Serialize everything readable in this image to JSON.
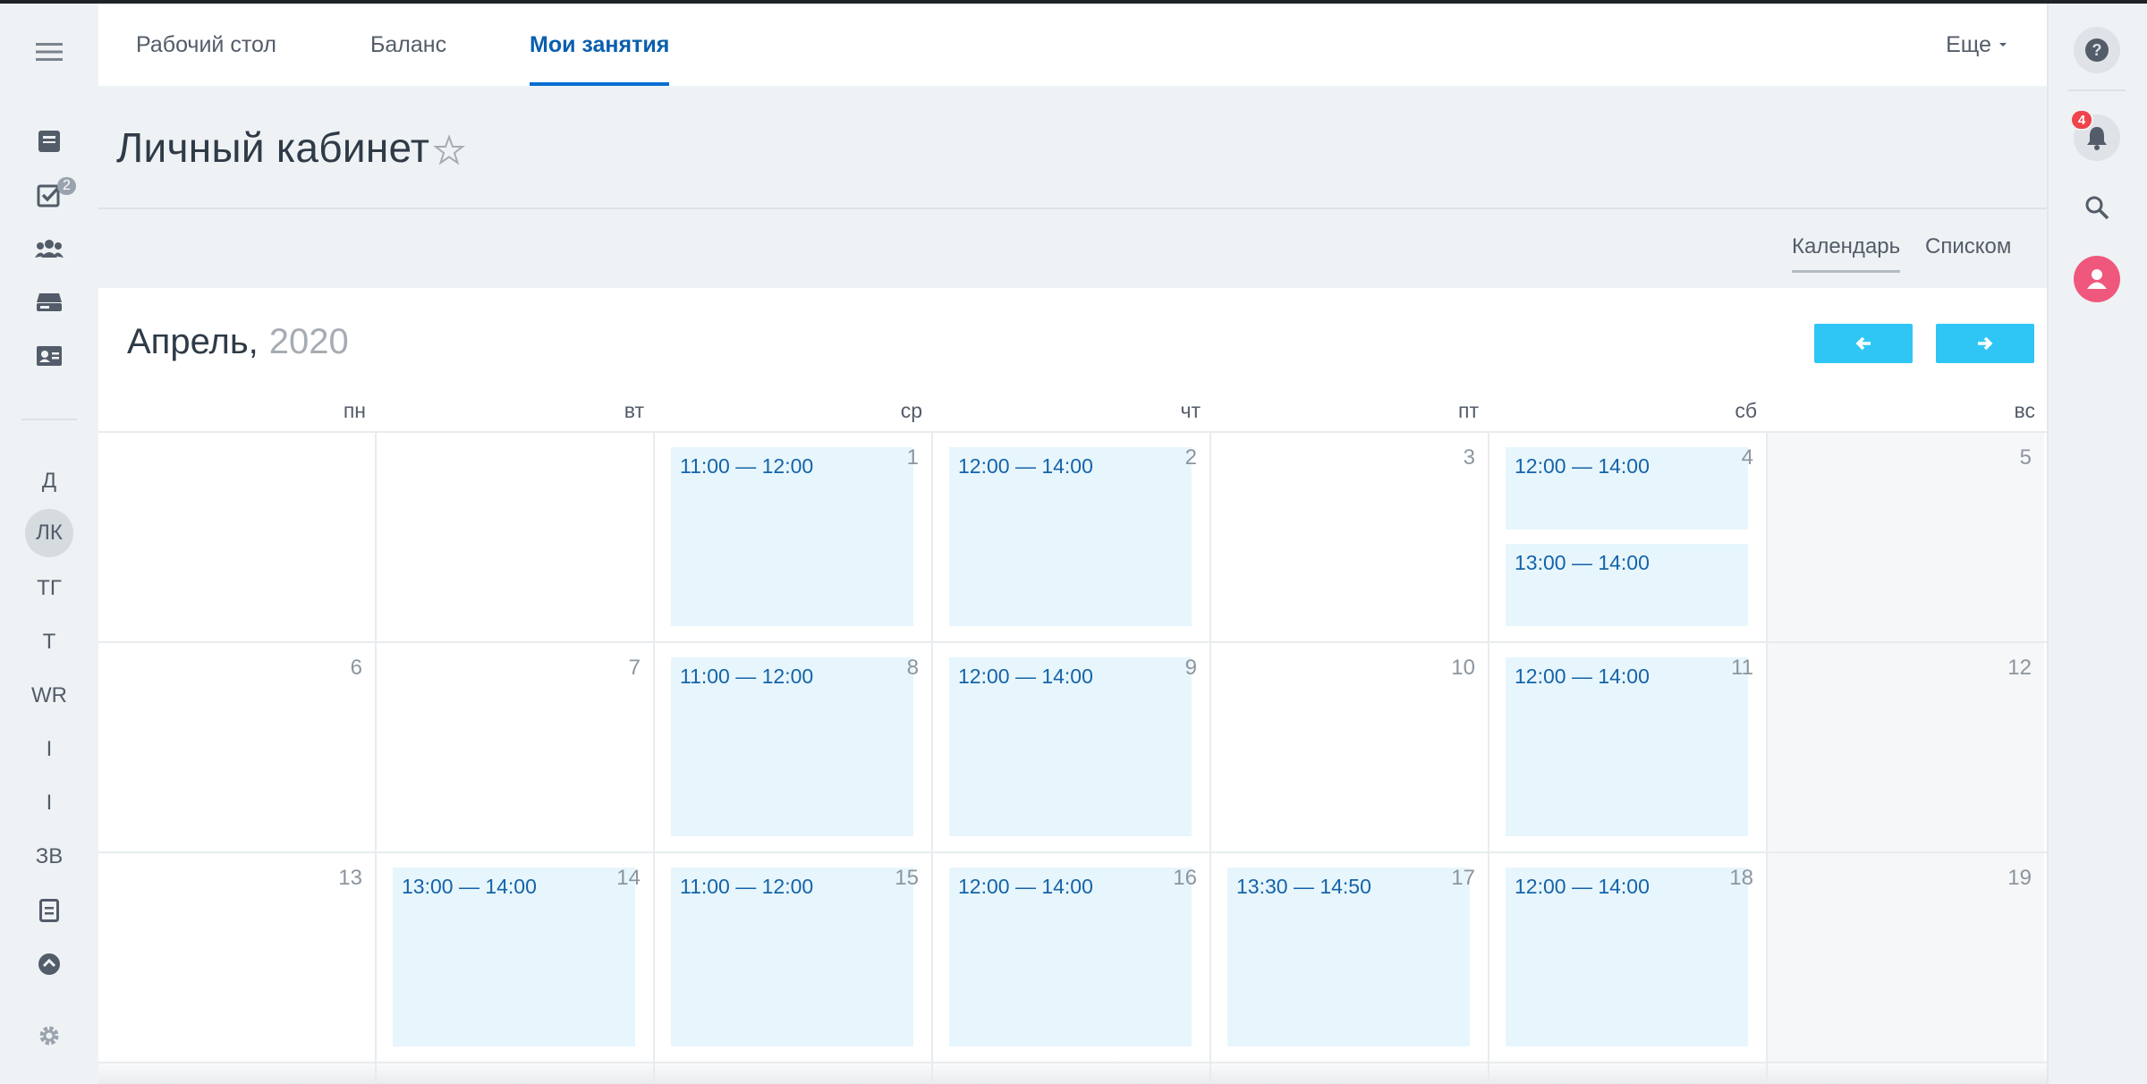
{
  "tabs": [
    {
      "label": "Рабочий стол"
    },
    {
      "label": "Баланс"
    },
    {
      "label": "Мои занятия"
    }
  ],
  "more_label": "Еще",
  "page_title": "Личный кабинет",
  "view_switch": {
    "calendar": "Календарь",
    "list": "Списком"
  },
  "calendar": {
    "month": "Апрель,",
    "year": "2020",
    "weekdays": [
      "пн",
      "вт",
      "ср",
      "чт",
      "пт",
      "сб",
      "вс"
    ],
    "weeks": [
      {
        "days": [
          "",
          "",
          "1",
          "2",
          "3",
          "4",
          "5"
        ]
      },
      {
        "days": [
          "6",
          "7",
          "8",
          "9",
          "10",
          "11",
          "12"
        ]
      },
      {
        "days": [
          "13",
          "14",
          "15",
          "16",
          "17",
          "18",
          "19"
        ]
      }
    ],
    "events": [
      {
        "day": "1",
        "time": "11:00 — 12:00"
      },
      {
        "day": "2",
        "time": "12:00 — 14:00"
      },
      {
        "day": "4",
        "time": "12:00 — 14:00"
      },
      {
        "day": "4",
        "time": "13:00 — 14:00"
      },
      {
        "day": "8",
        "time": "11:00 — 12:00"
      },
      {
        "day": "9",
        "time": "12:00 — 14:00"
      },
      {
        "day": "11",
        "time": "12:00 — 14:00"
      },
      {
        "day": "14",
        "time": "13:00 — 14:00"
      },
      {
        "day": "15",
        "time": "11:00 — 12:00"
      },
      {
        "day": "16",
        "time": "12:00 — 14:00"
      },
      {
        "day": "17",
        "time": "13:30 — 14:50"
      },
      {
        "day": "18",
        "time": "12:00 — 14:00"
      }
    ]
  },
  "left_sidebar": {
    "tasks_badge": "2",
    "text_items": [
      "Д",
      "ЛК",
      "ТГ",
      "Т",
      "WR",
      "I",
      "I",
      "ЗВ"
    ]
  },
  "notifications_badge": "4",
  "colors": {
    "accent": "#2fc6f6",
    "active_tab": "#0a5fad",
    "event_bg": "#e7f6fd",
    "badge": "#f0434b",
    "avatar": "#f0577d"
  }
}
